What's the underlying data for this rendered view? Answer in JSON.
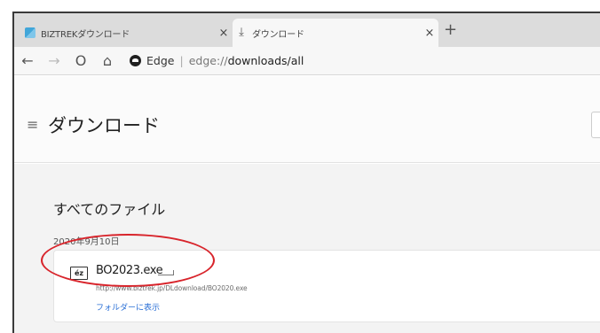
{
  "tabs": [
    {
      "title": "BIZTREKダウンロード",
      "icon": "biztrek-favicon",
      "close": "×"
    },
    {
      "title": "ダウンロード",
      "icon": "download-icon",
      "close": "×"
    }
  ],
  "new_tab": "+",
  "toolbar": {
    "back": "←",
    "forward": "→",
    "refresh": "O",
    "home": "⌂",
    "scheme_label": "Edge",
    "separator": "|",
    "url_prefix": "edge://",
    "url_path": "downloads/all"
  },
  "header": {
    "menu_icon": "≡",
    "title": "ダウンロード"
  },
  "content": {
    "section_title": "すべてのファイル",
    "date": "2020年9月10日",
    "item": {
      "file_icon_text": "éz",
      "file_name": "BO2023.exe",
      "url": "http://www.biztrek.jp/DLdownload/BO2020.exe",
      "action": "フォルダーに表示"
    }
  },
  "colors": {
    "highlight": "#d8242b",
    "link": "#2a6fd6"
  }
}
